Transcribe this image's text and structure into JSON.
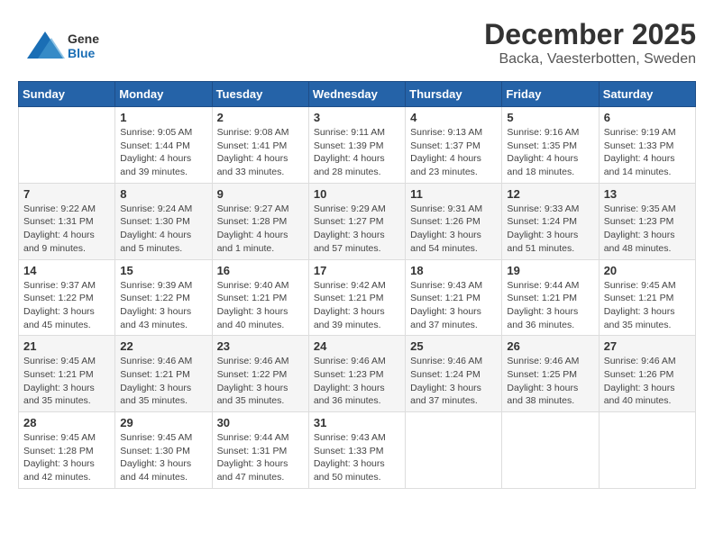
{
  "header": {
    "logo_general": "General",
    "logo_blue": "Blue",
    "month_title": "December 2025",
    "location": "Backa, Vaesterbotten, Sweden"
  },
  "days_of_week": [
    "Sunday",
    "Monday",
    "Tuesday",
    "Wednesday",
    "Thursday",
    "Friday",
    "Saturday"
  ],
  "weeks": [
    [
      {
        "day": "",
        "sunrise": "",
        "sunset": "",
        "daylight": ""
      },
      {
        "day": "1",
        "sunrise": "Sunrise: 9:05 AM",
        "sunset": "Sunset: 1:44 PM",
        "daylight": "Daylight: 4 hours and 39 minutes."
      },
      {
        "day": "2",
        "sunrise": "Sunrise: 9:08 AM",
        "sunset": "Sunset: 1:41 PM",
        "daylight": "Daylight: 4 hours and 33 minutes."
      },
      {
        "day": "3",
        "sunrise": "Sunrise: 9:11 AM",
        "sunset": "Sunset: 1:39 PM",
        "daylight": "Daylight: 4 hours and 28 minutes."
      },
      {
        "day": "4",
        "sunrise": "Sunrise: 9:13 AM",
        "sunset": "Sunset: 1:37 PM",
        "daylight": "Daylight: 4 hours and 23 minutes."
      },
      {
        "day": "5",
        "sunrise": "Sunrise: 9:16 AM",
        "sunset": "Sunset: 1:35 PM",
        "daylight": "Daylight: 4 hours and 18 minutes."
      },
      {
        "day": "6",
        "sunrise": "Sunrise: 9:19 AM",
        "sunset": "Sunset: 1:33 PM",
        "daylight": "Daylight: 4 hours and 14 minutes."
      }
    ],
    [
      {
        "day": "7",
        "sunrise": "Sunrise: 9:22 AM",
        "sunset": "Sunset: 1:31 PM",
        "daylight": "Daylight: 4 hours and 9 minutes."
      },
      {
        "day": "8",
        "sunrise": "Sunrise: 9:24 AM",
        "sunset": "Sunset: 1:30 PM",
        "daylight": "Daylight: 4 hours and 5 minutes."
      },
      {
        "day": "9",
        "sunrise": "Sunrise: 9:27 AM",
        "sunset": "Sunset: 1:28 PM",
        "daylight": "Daylight: 4 hours and 1 minute."
      },
      {
        "day": "10",
        "sunrise": "Sunrise: 9:29 AM",
        "sunset": "Sunset: 1:27 PM",
        "daylight": "Daylight: 3 hours and 57 minutes."
      },
      {
        "day": "11",
        "sunrise": "Sunrise: 9:31 AM",
        "sunset": "Sunset: 1:26 PM",
        "daylight": "Daylight: 3 hours and 54 minutes."
      },
      {
        "day": "12",
        "sunrise": "Sunrise: 9:33 AM",
        "sunset": "Sunset: 1:24 PM",
        "daylight": "Daylight: 3 hours and 51 minutes."
      },
      {
        "day": "13",
        "sunrise": "Sunrise: 9:35 AM",
        "sunset": "Sunset: 1:23 PM",
        "daylight": "Daylight: 3 hours and 48 minutes."
      }
    ],
    [
      {
        "day": "14",
        "sunrise": "Sunrise: 9:37 AM",
        "sunset": "Sunset: 1:22 PM",
        "daylight": "Daylight: 3 hours and 45 minutes."
      },
      {
        "day": "15",
        "sunrise": "Sunrise: 9:39 AM",
        "sunset": "Sunset: 1:22 PM",
        "daylight": "Daylight: 3 hours and 43 minutes."
      },
      {
        "day": "16",
        "sunrise": "Sunrise: 9:40 AM",
        "sunset": "Sunset: 1:21 PM",
        "daylight": "Daylight: 3 hours and 40 minutes."
      },
      {
        "day": "17",
        "sunrise": "Sunrise: 9:42 AM",
        "sunset": "Sunset: 1:21 PM",
        "daylight": "Daylight: 3 hours and 39 minutes."
      },
      {
        "day": "18",
        "sunrise": "Sunrise: 9:43 AM",
        "sunset": "Sunset: 1:21 PM",
        "daylight": "Daylight: 3 hours and 37 minutes."
      },
      {
        "day": "19",
        "sunrise": "Sunrise: 9:44 AM",
        "sunset": "Sunset: 1:21 PM",
        "daylight": "Daylight: 3 hours and 36 minutes."
      },
      {
        "day": "20",
        "sunrise": "Sunrise: 9:45 AM",
        "sunset": "Sunset: 1:21 PM",
        "daylight": "Daylight: 3 hours and 35 minutes."
      }
    ],
    [
      {
        "day": "21",
        "sunrise": "Sunrise: 9:45 AM",
        "sunset": "Sunset: 1:21 PM",
        "daylight": "Daylight: 3 hours and 35 minutes."
      },
      {
        "day": "22",
        "sunrise": "Sunrise: 9:46 AM",
        "sunset": "Sunset: 1:21 PM",
        "daylight": "Daylight: 3 hours and 35 minutes."
      },
      {
        "day": "23",
        "sunrise": "Sunrise: 9:46 AM",
        "sunset": "Sunset: 1:22 PM",
        "daylight": "Daylight: 3 hours and 35 minutes."
      },
      {
        "day": "24",
        "sunrise": "Sunrise: 9:46 AM",
        "sunset": "Sunset: 1:23 PM",
        "daylight": "Daylight: 3 hours and 36 minutes."
      },
      {
        "day": "25",
        "sunrise": "Sunrise: 9:46 AM",
        "sunset": "Sunset: 1:24 PM",
        "daylight": "Daylight: 3 hours and 37 minutes."
      },
      {
        "day": "26",
        "sunrise": "Sunrise: 9:46 AM",
        "sunset": "Sunset: 1:25 PM",
        "daylight": "Daylight: 3 hours and 38 minutes."
      },
      {
        "day": "27",
        "sunrise": "Sunrise: 9:46 AM",
        "sunset": "Sunset: 1:26 PM",
        "daylight": "Daylight: 3 hours and 40 minutes."
      }
    ],
    [
      {
        "day": "28",
        "sunrise": "Sunrise: 9:45 AM",
        "sunset": "Sunset: 1:28 PM",
        "daylight": "Daylight: 3 hours and 42 minutes."
      },
      {
        "day": "29",
        "sunrise": "Sunrise: 9:45 AM",
        "sunset": "Sunset: 1:30 PM",
        "daylight": "Daylight: 3 hours and 44 minutes."
      },
      {
        "day": "30",
        "sunrise": "Sunrise: 9:44 AM",
        "sunset": "Sunset: 1:31 PM",
        "daylight": "Daylight: 3 hours and 47 minutes."
      },
      {
        "day": "31",
        "sunrise": "Sunrise: 9:43 AM",
        "sunset": "Sunset: 1:33 PM",
        "daylight": "Daylight: 3 hours and 50 minutes."
      },
      {
        "day": "",
        "sunrise": "",
        "sunset": "",
        "daylight": ""
      },
      {
        "day": "",
        "sunrise": "",
        "sunset": "",
        "daylight": ""
      },
      {
        "day": "",
        "sunrise": "",
        "sunset": "",
        "daylight": ""
      }
    ]
  ]
}
